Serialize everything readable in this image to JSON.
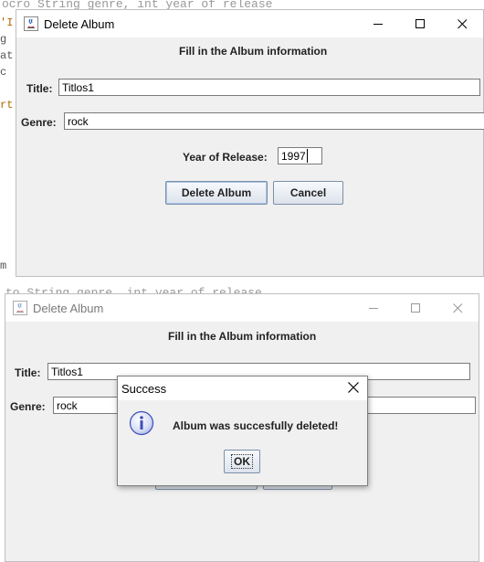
{
  "background": {
    "code_line_top": "ocro  String genre, int year of release",
    "code_line_mid": "to  String genre, int year of release",
    "side_chars_top": [
      "'I",
      "g",
      "at",
      "c",
      "",
      "rt"
    ],
    "side_char_bottom": "m"
  },
  "top_window": {
    "title": "Delete Album",
    "heading": "Fill in the Album information",
    "title_label": "Title:",
    "title_value": "Titlos1",
    "genre_label": "Genre:",
    "genre_value": "rock",
    "year_label": "Year of Release:",
    "year_value": "1997",
    "delete_label": "Delete Album",
    "cancel_label": "Cancel"
  },
  "bottom_window": {
    "title": "Delete Album",
    "heading": "Fill in the Album information",
    "title_label": "Title:",
    "title_value": "Titlos1",
    "genre_label": "Genre:",
    "genre_value": "rock"
  },
  "dialog": {
    "title": "Success",
    "message": "Album was succesfully deleted!",
    "ok_label": "OK",
    "icon": "info-icon"
  },
  "colors": {
    "window_bg": "#f0f0f0",
    "titlebar_bg": "#ffffff",
    "button_border": "#7c8fa8",
    "info_blue": "#3d4fb8"
  }
}
